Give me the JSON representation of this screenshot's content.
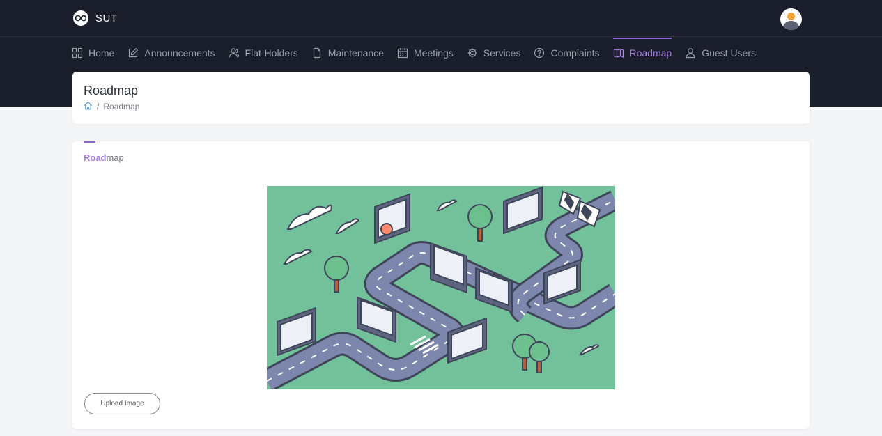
{
  "app": {
    "name": "SUT",
    "logo_icon": "infinity-icon",
    "avatar_icon": "user-avatar-icon"
  },
  "nav": {
    "items": [
      {
        "label": "Home",
        "icon": "grid-icon"
      },
      {
        "label": "Announcements",
        "icon": "edit-icon"
      },
      {
        "label": "Flat-Holders",
        "icon": "users-icon"
      },
      {
        "label": "Maintenance",
        "icon": "file-icon"
      },
      {
        "label": "Meetings",
        "icon": "calendar-icon"
      },
      {
        "label": "Services",
        "icon": "gear-icon"
      },
      {
        "label": "Complaints",
        "icon": "help-circle-icon"
      },
      {
        "label": "Roadmap",
        "icon": "map-icon",
        "active": true
      },
      {
        "label": "Guest Users",
        "icon": "user-icon"
      }
    ]
  },
  "page": {
    "title": "Roadmap",
    "breadcrumb_home_icon": "home-icon",
    "breadcrumb_separator": "/",
    "breadcrumb_current": "Roadmap"
  },
  "card": {
    "title_highlight": "Road",
    "title_rest": "map",
    "upload_label": "Upload Image"
  },
  "colors": {
    "accent": "#a57ee0",
    "topbar": "#1a1e2a",
    "illustration_bg": "#72c19b",
    "road": "#7d86ad"
  }
}
